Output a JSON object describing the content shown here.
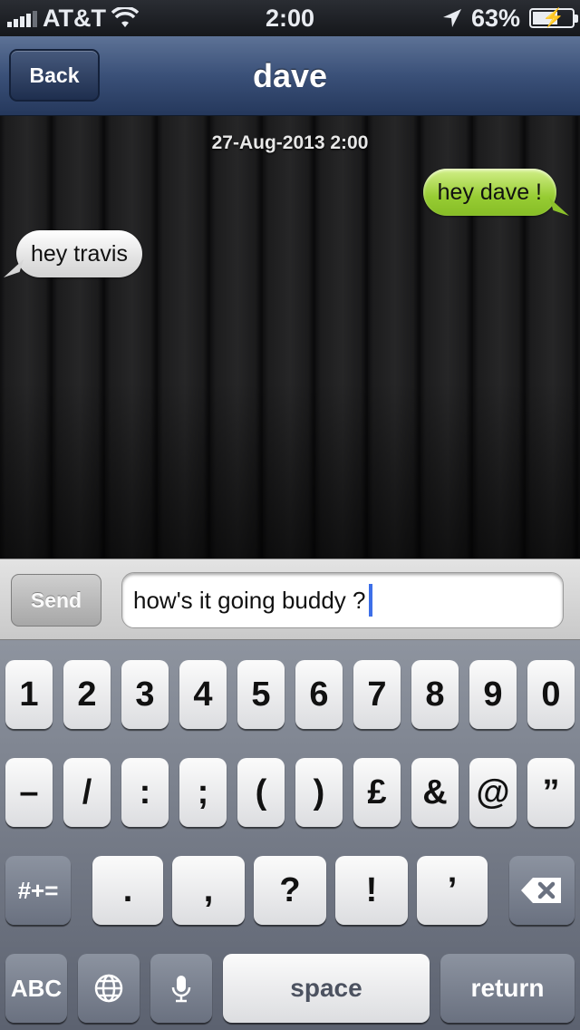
{
  "status_bar": {
    "carrier": "AT&T",
    "time": "2:00",
    "battery": "63%"
  },
  "nav": {
    "back_label": "Back",
    "title": "dave"
  },
  "chat": {
    "timestamp": "27-Aug-2013 2:00",
    "messages": [
      {
        "direction": "outgoing",
        "text": "hey dave !"
      },
      {
        "direction": "incoming",
        "text": "hey travis"
      }
    ]
  },
  "composer": {
    "send_label": "Send",
    "input_value": "how's it going buddy ?"
  },
  "keyboard": {
    "row1": [
      "1",
      "2",
      "3",
      "4",
      "5",
      "6",
      "7",
      "8",
      "9",
      "0"
    ],
    "row2": [
      "–",
      "/",
      ":",
      ";",
      "(",
      ")",
      "£",
      "&",
      "@",
      "”"
    ],
    "row3": {
      "shift": "#+=",
      "keys": [
        ".",
        ",",
        "?",
        "!",
        "’"
      ]
    },
    "row4": {
      "abc": "ABC",
      "space": "space",
      "return": "return"
    }
  },
  "colors": {
    "outgoing_bubble": "#97cc33",
    "incoming_bubble": "#e2e2e2",
    "nav_bar": "#3a5078",
    "caret": "#3d6fe8"
  }
}
